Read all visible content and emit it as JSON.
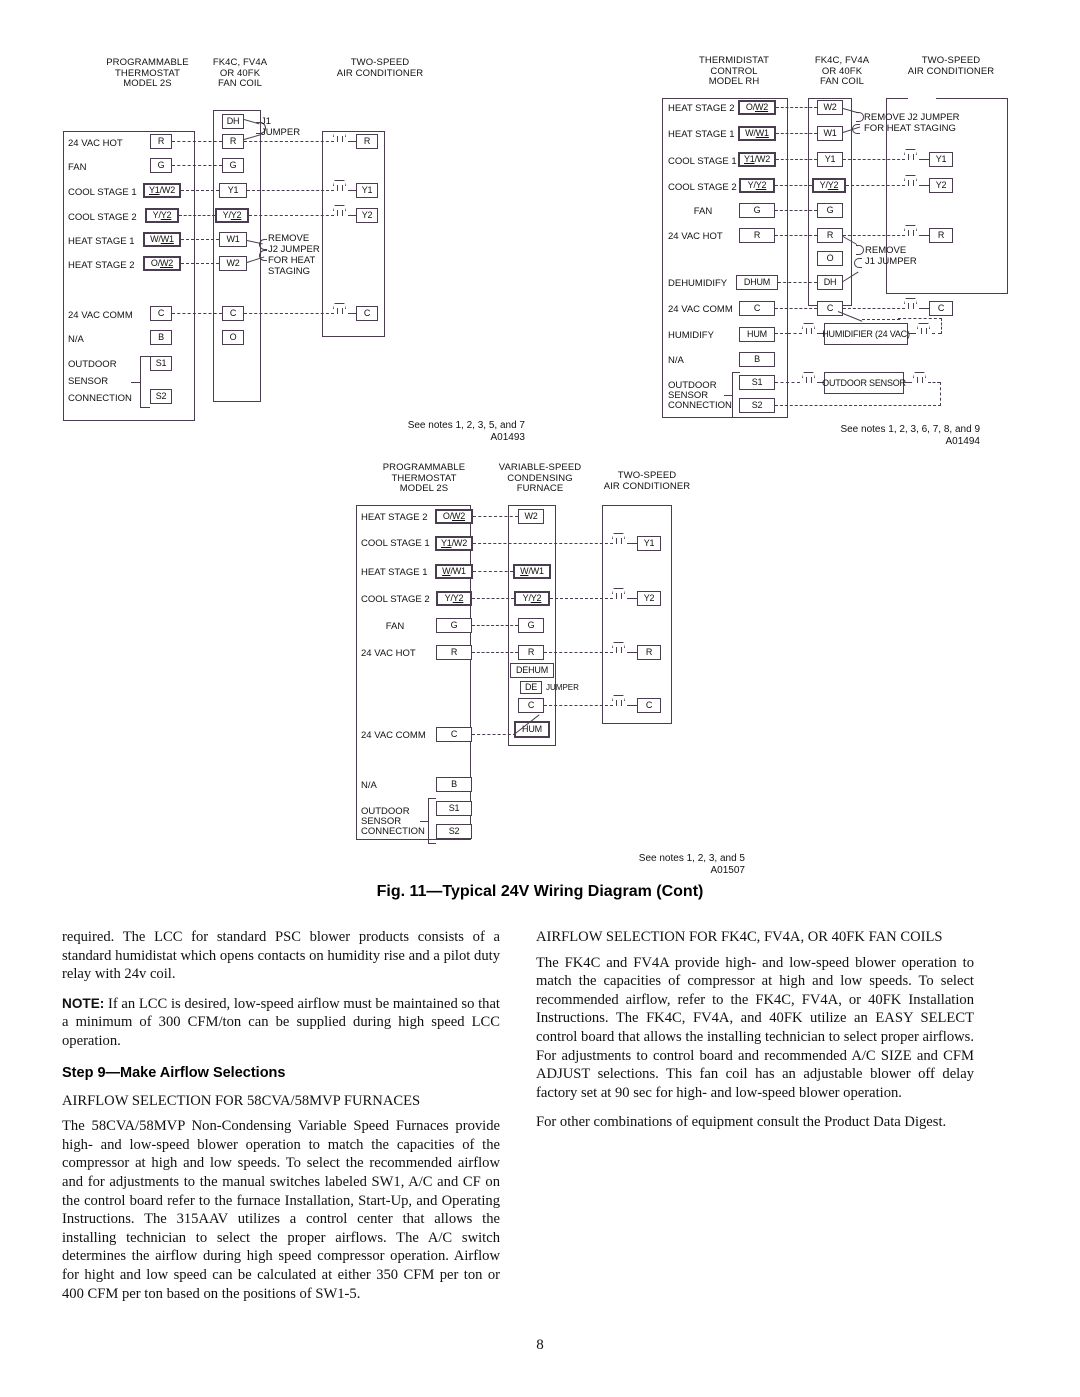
{
  "page": {
    "number": "8"
  },
  "figure": {
    "caption": "Fig. 11—Typical 24V Wiring Diagram (Cont)"
  },
  "diagrams": [
    {
      "id": "A01493",
      "headers": {
        "left": "PROGRAMMABLE\nTHERMOSTAT\nMODEL 2S",
        "middle": "FK4C, FV4A\nOR 40FK\nFAN COIL",
        "right": "TWO-SPEED\nAIR CONDITIONER"
      },
      "rows": [
        {
          "label": "24 VAC HOT",
          "left": "R",
          "middle": "R",
          "right": "R"
        },
        {
          "label": "FAN",
          "left": "G",
          "middle": "G",
          "right": ""
        },
        {
          "label": "COOL STAGE 1",
          "left": "Y1/W2",
          "middle": "Y1",
          "right": "Y1"
        },
        {
          "label": "COOL STAGE 2",
          "left": "Y/Y2",
          "middle": "Y/Y2",
          "right": "Y2"
        },
        {
          "label": "HEAT STAGE 1",
          "left": "W/W1",
          "middle": "W1",
          "right": ""
        },
        {
          "label": "HEAT STAGE 2",
          "left": "O/W2",
          "middle": "W2",
          "right": ""
        },
        {
          "label": "24 VAC COMM",
          "left": "C",
          "middle": "C",
          "right": "C"
        },
        {
          "label": "N/A",
          "left": "B",
          "middle": "O",
          "right": ""
        },
        {
          "label": "OUTDOOR",
          "left": "S1",
          "middle": "",
          "right": ""
        },
        {
          "label": "SENSOR",
          "left": "",
          "middle": "",
          "right": ""
        },
        {
          "label": "CONNECTION",
          "left": "S2",
          "middle": "",
          "right": ""
        }
      ],
      "extra_terminals": [
        {
          "name": "DH"
        }
      ],
      "annotations": [
        {
          "text": "J1\nJUMPER"
        },
        {
          "text": "REMOVE\nJ2 JUMPER\nFOR HEAT\nSTAGING"
        }
      ],
      "see_notes": "See notes 1, 2, 3, 5, and 7\nA01493"
    },
    {
      "id": "A01494",
      "headers": {
        "left": "THERMIDISTAT\nCONTROL\nMODEL RH",
        "middle": "FK4C, FV4A\nOR 40FK\nFAN COIL",
        "right": "TWO-SPEED\nAIR CONDITIONER"
      },
      "rows": [
        {
          "label": "HEAT STAGE 2",
          "left": "O/W2",
          "middle": "W2",
          "right": ""
        },
        {
          "label": "HEAT STAGE 1",
          "left": "W/W1",
          "middle": "W1",
          "right": ""
        },
        {
          "label": "COOL STAGE 1",
          "left": "Y1/W2",
          "middle": "Y1",
          "right": "Y1"
        },
        {
          "label": "COOL STAGE 2",
          "left": "Y/Y2",
          "middle": "Y/Y2",
          "right": "Y2"
        },
        {
          "label": "FAN",
          "left": "G",
          "middle": "G",
          "right": ""
        },
        {
          "label": "24 VAC HOT",
          "left": "R",
          "middle": "R",
          "right": "R"
        },
        {
          "label": "",
          "left": "",
          "middle": "O",
          "right": ""
        },
        {
          "label": "DEHUMIDIFY",
          "left": "DHUM",
          "middle": "DH",
          "right": ""
        },
        {
          "label": "24 VAC COMM",
          "left": "C",
          "middle": "C",
          "right": "C"
        },
        {
          "label": "HUMIDIFY",
          "left": "HUM",
          "middle": "",
          "right": ""
        },
        {
          "label": "N/A",
          "left": "B",
          "middle": "",
          "right": ""
        },
        {
          "label": "OUTDOOR",
          "left": "S1",
          "middle": "",
          "right": ""
        },
        {
          "label": "SENSOR",
          "left": "",
          "middle": "",
          "right": ""
        },
        {
          "label": "CONNECTION",
          "left": "S2",
          "middle": "",
          "right": ""
        }
      ],
      "devices": [
        {
          "name": "HUMIDIFIER\n(24 VAC)"
        },
        {
          "name": "OUTDOOR\nSENSOR"
        }
      ],
      "annotations": [
        {
          "text": "REMOVE J2 JUMPER\nFOR HEAT STAGING"
        },
        {
          "text": "REMOVE\nJ1 JUMPER"
        }
      ],
      "see_notes": "See notes 1, 2, 3, 6, 7, 8, and 9\nA01494"
    },
    {
      "id": "A01507",
      "headers": {
        "left": "PROGRAMMABLE\nTHERMOSTAT\nMODEL 2S",
        "middle": "VARIABLE-SPEED\nCONDENSING\nFURNACE",
        "right": "TWO-SPEED\nAIR CONDITIONER"
      },
      "rows": [
        {
          "label": "HEAT STAGE 2",
          "left": "O/W2",
          "middle": "W2",
          "right": ""
        },
        {
          "label": "COOL STAGE 1",
          "left": "Y1/W2",
          "middle": "",
          "right": "Y1"
        },
        {
          "label": "HEAT STAGE 1",
          "left": "W/W1",
          "middle": "W/W1",
          "right": ""
        },
        {
          "label": "COOL STAGE 2",
          "left": "Y/Y2",
          "middle": "Y/Y2",
          "right": "Y2"
        },
        {
          "label": "FAN",
          "left": "G",
          "middle": "G",
          "right": ""
        },
        {
          "label": "24 VAC HOT",
          "left": "R",
          "middle": "R",
          "right": "R"
        },
        {
          "label": "",
          "left": "",
          "middle": "DEHUM",
          "right": ""
        },
        {
          "label": "",
          "left": "",
          "middle": "DE",
          "right": ""
        },
        {
          "label": "",
          "left": "",
          "middle": "C",
          "right": "C"
        },
        {
          "label": "24 VAC COMM",
          "left": "C",
          "middle": "HUM",
          "right": ""
        },
        {
          "label": "N/A",
          "left": "B",
          "middle": "",
          "right": ""
        },
        {
          "label": "OUTDOOR",
          "left": "S1",
          "middle": "",
          "right": ""
        },
        {
          "label": "SENSOR",
          "left": "",
          "middle": "",
          "right": ""
        },
        {
          "label": "CONNECTION",
          "left": "S2",
          "middle": "",
          "right": ""
        }
      ],
      "annotations": [
        {
          "text": "JUMPER"
        }
      ],
      "see_notes": "See notes 1, 2, 3, and 5\nA01507"
    }
  ],
  "body": {
    "left_column": {
      "para1": "required. The LCC for standard PSC blower products consists of a standard humidistat which opens contacts on humidity rise and a pilot duty relay with 24v coil.",
      "note_label": "NOTE:",
      "note_text": " If an LCC is desired, low-speed airflow must be maintained so that a minimum of 300 CFM/ton can be supplied during high speed LCC operation.",
      "heading": "Step 9—Make Airflow Selections",
      "subhead": "AIRFLOW SELECTION FOR 58CVA/58MVP FURNACES",
      "para2": "The 58CVA/58MVP Non-Condensing Variable Speed Furnaces provide high- and low-speed blower operation to match the capacities of the compressor at high and low speeds. To select the recommended airflow and for adjustments to the manual switches labeled SW1, A/C and CF on the control board refer to the furnace Installation, Start-Up, and Operating Instructions. The 315AAV utilizes a control center that allows the installing technician to select the proper airflows. The A/C switch determines the airflow during high speed compressor operation. Airflow for hight and low speed can be calculated at either 350 CFM per ton or 400 CFM per ton based on the positions of SW1-5."
    },
    "right_column": {
      "subhead": "AIRFLOW SELECTION FOR FK4C, FV4A, OR 40FK FAN COILS",
      "para1": "The FK4C and FV4A provide high- and low-speed blower operation to match the capacities of compressor at high and low speeds. To select recommended airflow, refer to the FK4C, FV4A, or 40FK Installation Instructions. The FK4C, FV4A, and 40FK utilize an EASY SELECT control board that allows the installing technician to select proper airflows. For adjustments to control board and recommended A/C SIZE and CFM ADJUST selections. This fan coil has an adjustable blower off delay factory set at 90 sec for high- and low-speed blower operation.",
      "para2": "For other combinations of equipment consult the Product Data Digest."
    }
  }
}
